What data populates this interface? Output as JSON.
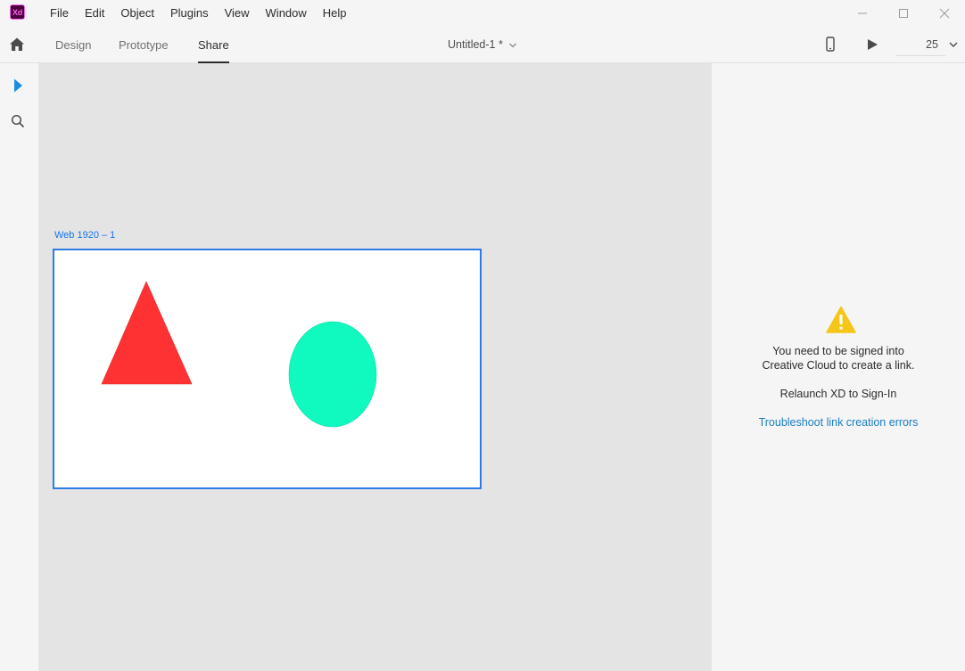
{
  "app": {
    "logo_text": "Xd",
    "logo_color": "#ff61f6",
    "logo_bg": "#470137"
  },
  "menu": {
    "items": [
      {
        "label": "File"
      },
      {
        "label": "Edit"
      },
      {
        "label": "Object"
      },
      {
        "label": "Plugins"
      },
      {
        "label": "View"
      },
      {
        "label": "Window"
      },
      {
        "label": "Help"
      }
    ]
  },
  "window_controls": [
    "minimize-icon",
    "maximize-icon",
    "close-icon"
  ],
  "toolbar": {
    "home_icon": "home-icon",
    "tabs": [
      {
        "label": "Design",
        "active": false
      },
      {
        "label": "Prototype",
        "active": false
      },
      {
        "label": "Share",
        "active": true
      }
    ],
    "document_title": "Untitled-1 *",
    "device_preview_icon": "mobile-device-icon",
    "play_icon": "play-icon",
    "zoom_value": "25"
  },
  "left_tools": [
    {
      "icon": "select-arrow-icon",
      "active": true
    },
    {
      "icon": "search-icon",
      "active": false
    }
  ],
  "canvas": {
    "artboard_label": "Web 1920 – 1",
    "artboard_border_color": "#2d7be5",
    "shapes": [
      {
        "kind": "triangle",
        "fill": "#fe3233"
      },
      {
        "kind": "ellipse",
        "fill": "#10fabf"
      }
    ]
  },
  "share_panel": {
    "warning_icon": "warning-icon",
    "warning_color": "#f5c518",
    "message": "You need to be signed into Creative Cloud to create a link.",
    "relaunch_text": "Relaunch XD to Sign-In",
    "link_text": "Troubleshoot link creation errors",
    "link_color": "#1a7dc1"
  }
}
